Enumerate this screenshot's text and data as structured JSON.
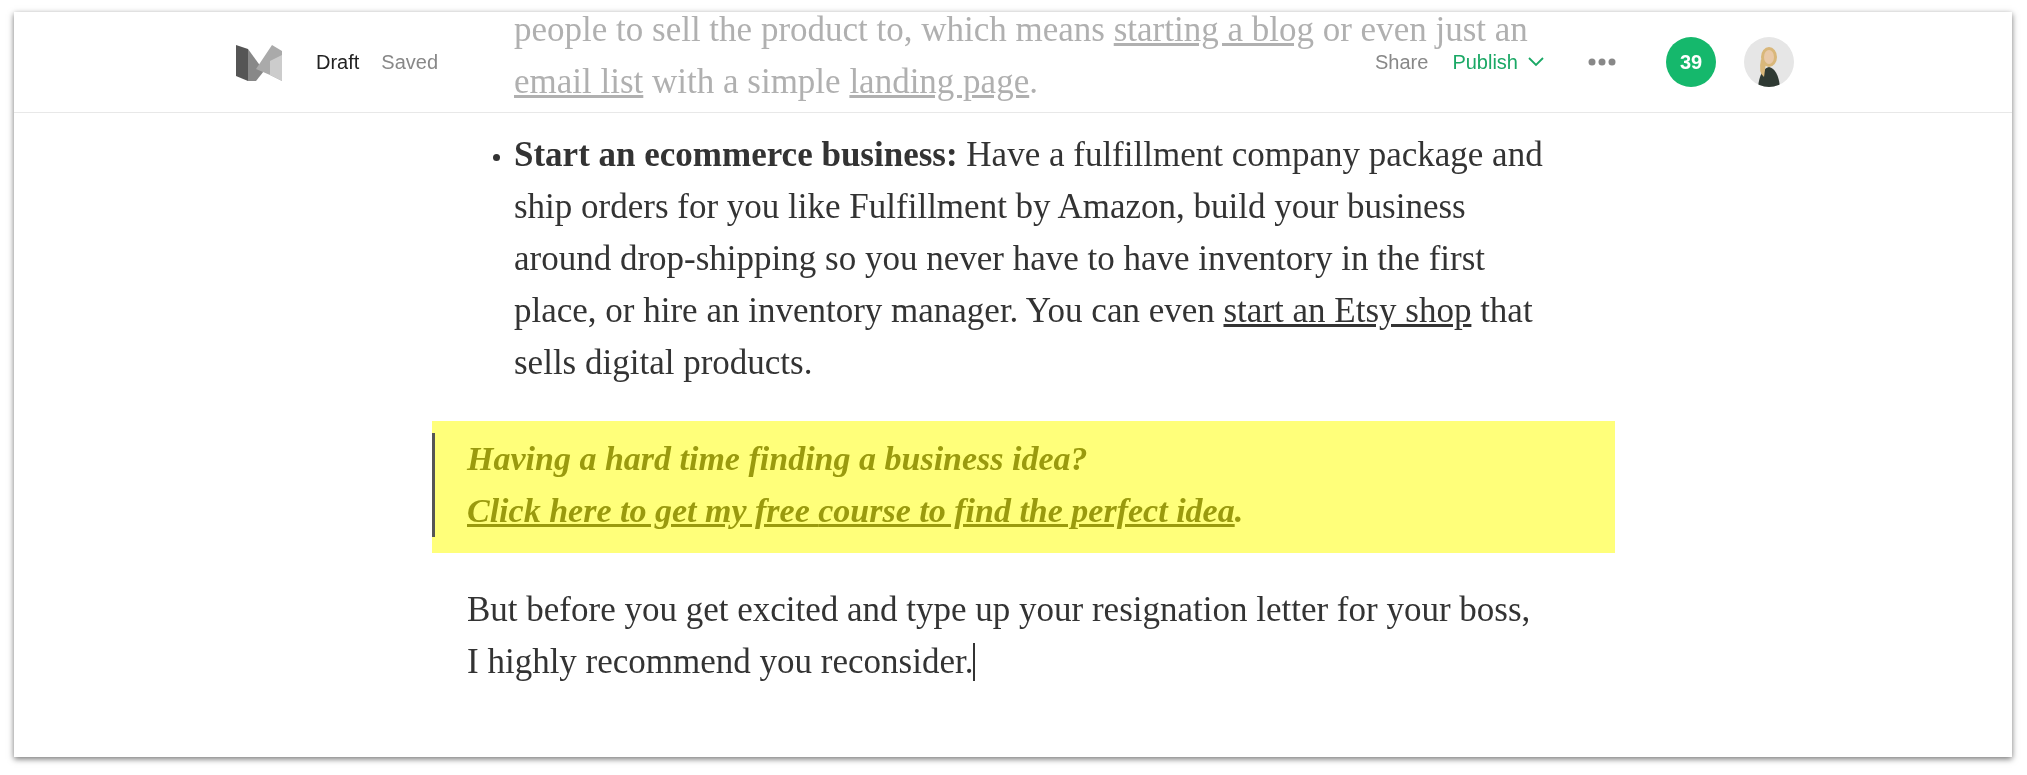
{
  "header": {
    "status": "Draft",
    "save_state": "Saved",
    "share": "Share",
    "publish": "Publish",
    "notifications": "39"
  },
  "article": [
    {
      "kind": "bullet_continuation",
      "faded": true,
      "lines": [
        [
          {
            "kind": "text",
            "text": "people to sell the product to, which means "
          },
          {
            "kind": "link",
            "text": "starting a blog"
          },
          {
            "kind": "text",
            "text": " or even just an"
          }
        ],
        [
          {
            "kind": "link",
            "text": "email list"
          },
          {
            "kind": "text",
            "text": " with a simple "
          },
          {
            "kind": "link",
            "text": "landing page"
          },
          {
            "kind": "text",
            "text": "."
          }
        ]
      ]
    },
    {
      "kind": "bullet",
      "faded": false,
      "segments": [
        {
          "kind": "bold",
          "text": "Start an ecommerce business:"
        },
        {
          "kind": "text",
          "text": " Have a fulfillment company package and ship orders for you like Fulfillment by Amazon, build your business around drop-shipping so you never have to have inventory in the first place, or hire an inventory manager. You can even "
        },
        {
          "kind": "link",
          "text": "start an Etsy shop"
        },
        {
          "kind": "text",
          "text": " that sells digital products."
        }
      ]
    },
    {
      "kind": "callout",
      "faded": false,
      "segments": [
        {
          "kind": "text",
          "text": "Having a hard time finding a business idea? "
        },
        {
          "kind": "link",
          "text": "Click here to get my free "
        },
        {
          "kind": "link",
          "text": "course to find the perfect idea"
        },
        {
          "kind": "text",
          "text": "."
        }
      ]
    },
    {
      "kind": "paragraph",
      "faded": false,
      "cursor": true,
      "segments": [
        {
          "kind": "text",
          "text": "But before you get excited and type up your resignation letter for your boss, I highly recommend you reconsider."
        }
      ]
    }
  ]
}
